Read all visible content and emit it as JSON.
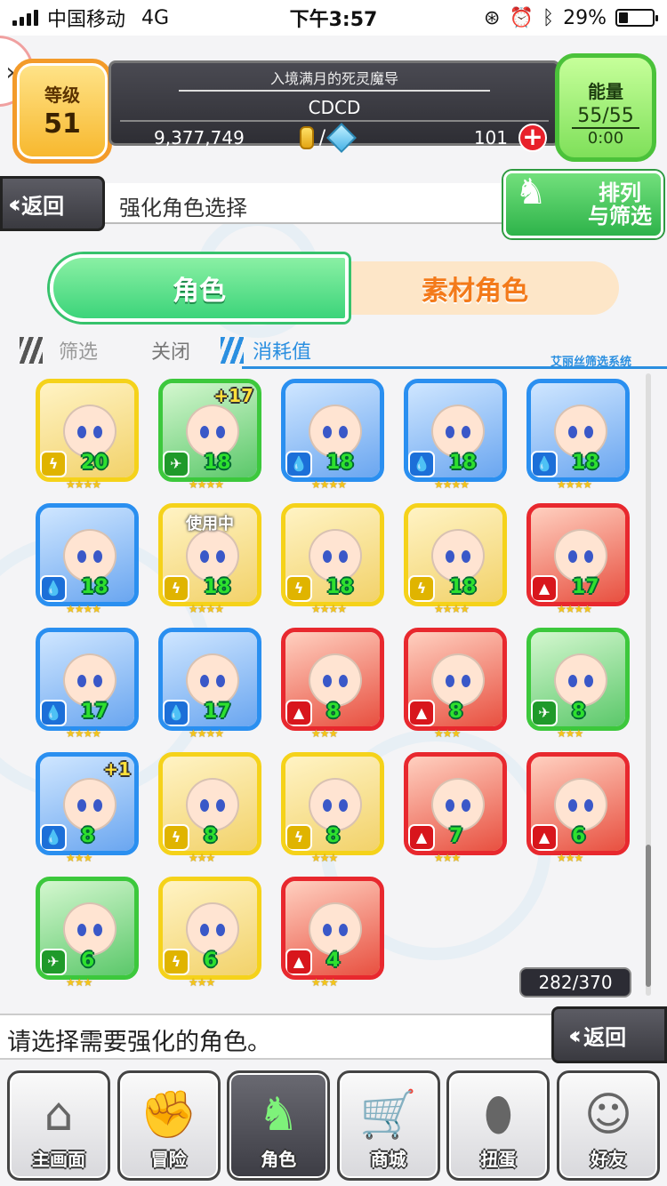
{
  "status_bar": {
    "carrier": "中国移动",
    "network": "4G",
    "time": "下午3:57",
    "battery": "29%",
    "battery_fraction": 0.29
  },
  "header": {
    "level_label": "等级",
    "level_value": "51",
    "player_title": "入境满月的死灵魔导",
    "player_name": "CDCD",
    "coins": "9,377,749",
    "gems": "101",
    "energy_label": "能量",
    "energy_value": "55/55",
    "energy_timer": "0:00"
  },
  "nav": {
    "back_label": "返回",
    "page_title": "强化角色选择",
    "sort_label_1": "排列",
    "sort_label_2": "与筛选"
  },
  "tabs": {
    "character": "角色",
    "material": "素材角色"
  },
  "filter": {
    "label": "筛选",
    "value": "关闭",
    "sort_label": "消耗值",
    "system_label": "艾丽丝筛选系统"
  },
  "characters": [
    {
      "level": "20",
      "stars": "★★★★",
      "attr": "thunder",
      "frame": "#f5d21a",
      "plus": "",
      "using": ""
    },
    {
      "level": "18",
      "stars": "★★★★",
      "attr": "wind",
      "frame": "#3cc83c",
      "plus": "+17",
      "using": ""
    },
    {
      "level": "18",
      "stars": "★★★★",
      "attr": "water",
      "frame": "#2a8ff0",
      "plus": "",
      "using": ""
    },
    {
      "level": "18",
      "stars": "★★★★",
      "attr": "water",
      "frame": "#2a8ff0",
      "plus": "",
      "using": ""
    },
    {
      "level": "18",
      "stars": "★★★★",
      "attr": "water",
      "frame": "#2a8ff0",
      "plus": "",
      "using": ""
    },
    {
      "level": "18",
      "stars": "★★★★",
      "attr": "water",
      "frame": "#2a8ff0",
      "plus": "",
      "using": ""
    },
    {
      "level": "18",
      "stars": "★★★★",
      "attr": "thunder",
      "frame": "#f5d21a",
      "plus": "",
      "using": "使用中"
    },
    {
      "level": "18",
      "stars": "★★★★",
      "attr": "thunder",
      "frame": "#f5d21a",
      "plus": "",
      "using": ""
    },
    {
      "level": "18",
      "stars": "★★★★",
      "attr": "thunder",
      "frame": "#f5d21a",
      "plus": "",
      "using": ""
    },
    {
      "level": "17",
      "stars": "★★★★",
      "attr": "fire",
      "frame": "#e8282e",
      "plus": "",
      "using": ""
    },
    {
      "level": "17",
      "stars": "★★★★",
      "attr": "water",
      "frame": "#2a8ff0",
      "plus": "",
      "using": ""
    },
    {
      "level": "17",
      "stars": "★★★★",
      "attr": "water",
      "frame": "#2a8ff0",
      "plus": "",
      "using": ""
    },
    {
      "level": "8",
      "stars": "★★★",
      "attr": "fire",
      "frame": "#e8282e",
      "plus": "",
      "using": ""
    },
    {
      "level": "8",
      "stars": "★★★",
      "attr": "fire",
      "frame": "#e8282e",
      "plus": "",
      "using": ""
    },
    {
      "level": "8",
      "stars": "★★★",
      "attr": "wind",
      "frame": "#3cc83c",
      "plus": "",
      "using": ""
    },
    {
      "level": "8",
      "stars": "★★★",
      "attr": "water",
      "frame": "#2a8ff0",
      "plus": "+1",
      "using": ""
    },
    {
      "level": "8",
      "stars": "★★★",
      "attr": "thunder",
      "frame": "#f5d21a",
      "plus": "",
      "using": ""
    },
    {
      "level": "8",
      "stars": "★★★",
      "attr": "thunder",
      "frame": "#f5d21a",
      "plus": "",
      "using": ""
    },
    {
      "level": "7",
      "stars": "★★★",
      "attr": "fire",
      "frame": "#e8282e",
      "plus": "",
      "using": ""
    },
    {
      "level": "6",
      "stars": "★★★",
      "attr": "fire",
      "frame": "#e8282e",
      "plus": "",
      "using": ""
    },
    {
      "level": "6",
      "stars": "★★★",
      "attr": "wind",
      "frame": "#3cc83c",
      "plus": "",
      "using": ""
    },
    {
      "level": "6",
      "stars": "★★★",
      "attr": "thunder",
      "frame": "#f5d21a",
      "plus": "",
      "using": ""
    },
    {
      "level": "4",
      "stars": "★★★",
      "attr": "fire",
      "frame": "#e8282e",
      "plus": "",
      "using": ""
    }
  ],
  "inventory_count": "282/370",
  "message": "请选择需要强化的角色。",
  "back_label_2": "返回",
  "bottom_nav": [
    {
      "label": "主画面",
      "icon": "home-icon",
      "glyph": "⌂",
      "active": false
    },
    {
      "label": "冒险",
      "icon": "handshake-icon",
      "glyph": "✊",
      "active": false
    },
    {
      "label": "角色",
      "icon": "rabbit-icon",
      "glyph": "♞",
      "active": true
    },
    {
      "label": "商城",
      "icon": "cart-icon",
      "glyph": "🛒",
      "active": false
    },
    {
      "label": "扭蛋",
      "icon": "egg-icon",
      "glyph": "⬮",
      "active": false
    },
    {
      "label": "好友",
      "icon": "friends-icon",
      "glyph": "☺",
      "active": false
    }
  ]
}
